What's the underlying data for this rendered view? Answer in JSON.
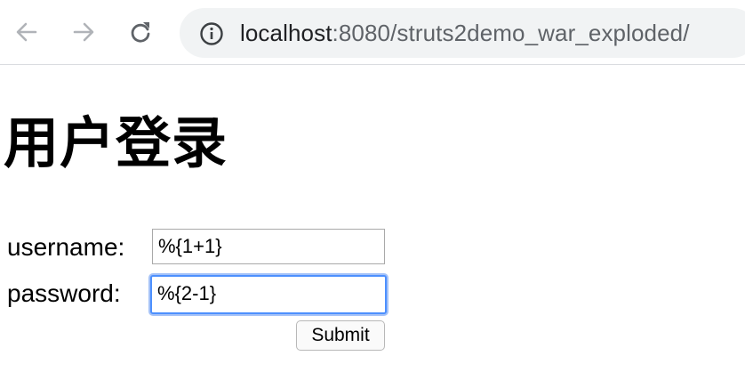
{
  "browser": {
    "url_host": "localhost",
    "url_rest": ":8080/struts2demo_war_exploded/",
    "icons": {
      "back": "back-arrow-icon",
      "forward": "forward-arrow-icon",
      "reload": "reload-icon",
      "site_info": "info-icon"
    }
  },
  "page": {
    "title": "用户登录",
    "form": {
      "username_label": "username:",
      "username_value": "%{1+1}",
      "password_label": "password:",
      "password_value": "%{2-1}",
      "submit_label": "Submit"
    }
  },
  "colors": {
    "focus_ring": "#4d90fe",
    "omnibox_bg": "#f1f3f4"
  }
}
